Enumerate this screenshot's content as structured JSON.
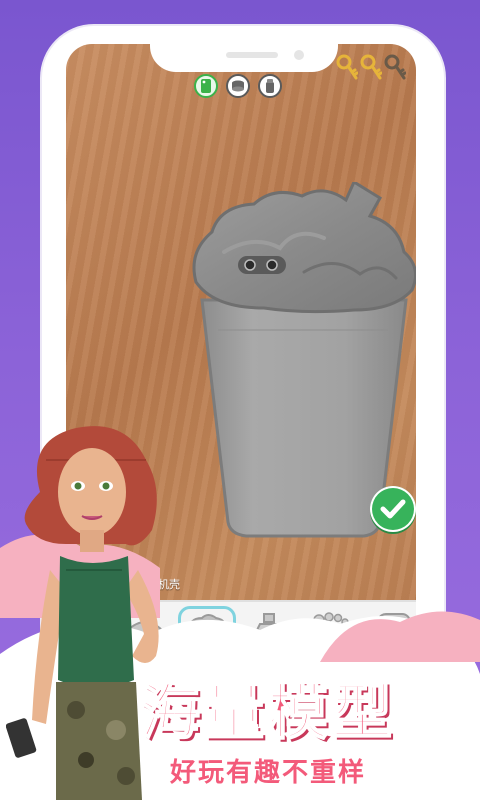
{
  "top_icons": [
    {
      "name": "phone-case-icon",
      "active": true
    },
    {
      "name": "coin-stack-icon",
      "active": false
    },
    {
      "name": "salt-shaker-icon",
      "active": false
    }
  ],
  "keys": {
    "collected": 2,
    "total": 3,
    "color_collected": "#e6b43a",
    "color_empty": "#6a5a48"
  },
  "hint_text": "个手机壳",
  "tray": {
    "items": [
      {
        "name": "shell-mold",
        "selected": false
      },
      {
        "name": "milkshake-cup-mold",
        "selected": true
      },
      {
        "name": "bottle-mold",
        "selected": false
      },
      {
        "name": "foot-mold",
        "selected": false
      },
      {
        "name": "phone-case-mold",
        "selected": false
      }
    ]
  },
  "banner": {
    "title": "海量模型",
    "subtitle": "好玩有趣不重样"
  },
  "colors": {
    "background": "#8a60d6",
    "accent": "#f35a7a",
    "confirm": "#37b35b",
    "mold": "#9a9a9a"
  }
}
